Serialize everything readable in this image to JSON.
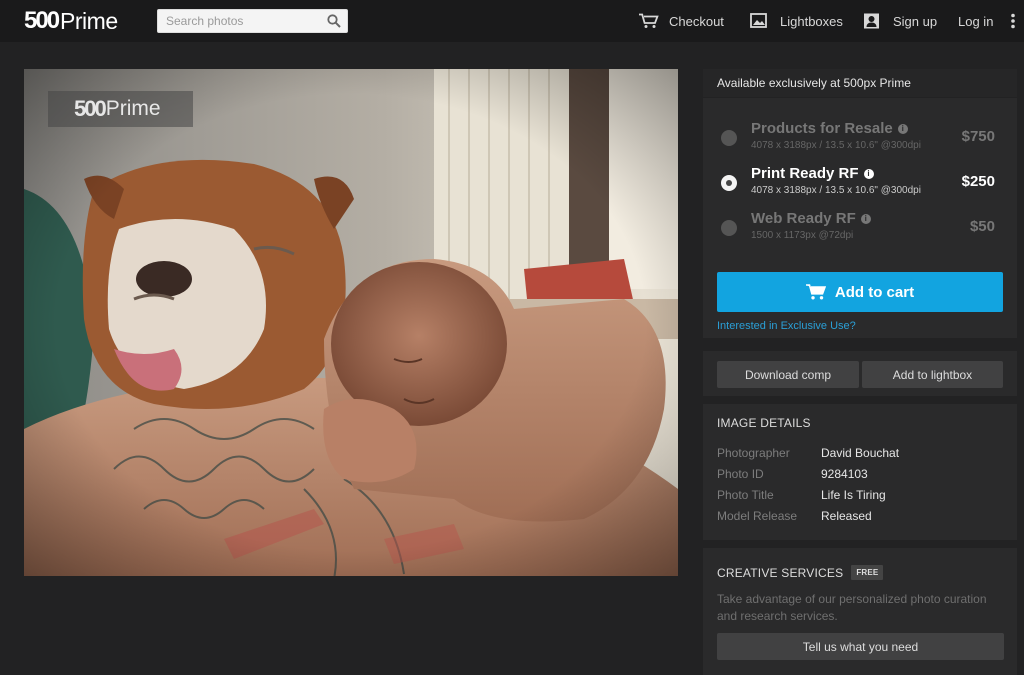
{
  "brand": {
    "logo_num": "500",
    "logo_word": "Prime"
  },
  "search": {
    "placeholder": "Search photos"
  },
  "nav": {
    "checkout": "Checkout",
    "lightboxes": "Lightboxes",
    "signup": "Sign up",
    "login": "Log in"
  },
  "photo": {
    "watermark_num": "500",
    "watermark_word": "Prime"
  },
  "sidebar": {
    "availability": "Available exclusively at 500px Prime",
    "options": [
      {
        "name": "Products for Resale",
        "dims": "4078 x 3188px / 13.5 x 10.6\" @300dpi",
        "price": "$750",
        "selected": false
      },
      {
        "name": "Print Ready RF",
        "dims": "4078 x 3188px / 13.5 x 10.6\" @300dpi",
        "price": "$250",
        "selected": true
      },
      {
        "name": "Web Ready RF",
        "dims": "1500 x 1173px @72dpi",
        "price": "$50",
        "selected": false
      }
    ],
    "add_to_cart": "Add to cart",
    "exclusive_link": "Interested in Exclusive Use?",
    "download_comp": "Download comp",
    "add_to_lightbox": "Add to lightbox",
    "details": {
      "heading": "IMAGE DETAILS",
      "rows": [
        {
          "key": "Photographer",
          "value": "David Bouchat"
        },
        {
          "key": "Photo ID",
          "value": "9284103"
        },
        {
          "key": "Photo Title",
          "value": "Life Is Tiring"
        },
        {
          "key": "Model Release",
          "value": "Released"
        }
      ]
    },
    "creative": {
      "heading": "CREATIVE SERVICES",
      "badge": "FREE",
      "text": "Take advantage of our personalized photo curation and research services.",
      "button": "Tell us what you need"
    }
  },
  "colors": {
    "accent": "#12a4e0",
    "link": "#2a9fd6",
    "background": "#222223",
    "topbar": "#1a1a1b",
    "panel": "#2a2a2b"
  },
  "icons": {
    "search": "search-icon",
    "cart": "cart-icon",
    "lightbox": "lightbox-icon",
    "user": "user-icon",
    "more": "more-vertical-icon",
    "info": "info-icon"
  }
}
